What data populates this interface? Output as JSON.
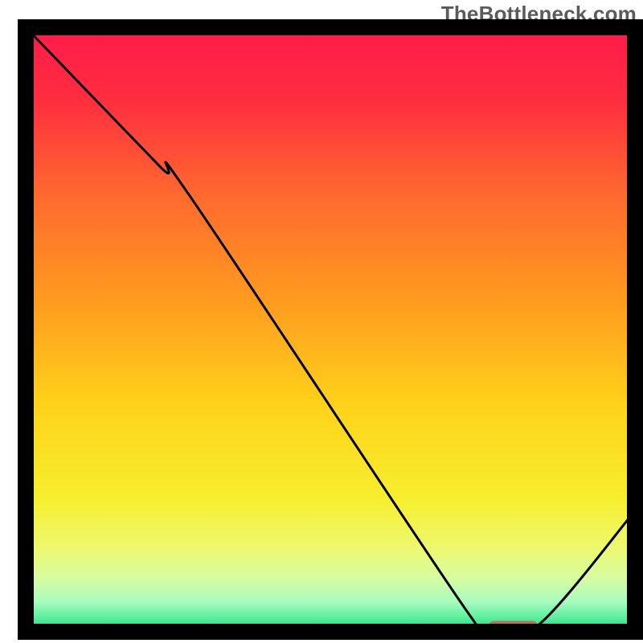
{
  "watermark": "TheBottleneck.com",
  "colors": {
    "frame": "#000000",
    "curve": "#000000",
    "marker": "#d9635f",
    "gradient_stops": [
      {
        "offset": 0.0,
        "color": "#ff1a4b"
      },
      {
        "offset": 0.12,
        "color": "#ff2e3f"
      },
      {
        "offset": 0.28,
        "color": "#ff6a2e"
      },
      {
        "offset": 0.45,
        "color": "#ff9a1f"
      },
      {
        "offset": 0.62,
        "color": "#ffd11a"
      },
      {
        "offset": 0.78,
        "color": "#f6ef2e"
      },
      {
        "offset": 0.86,
        "color": "#eef86e"
      },
      {
        "offset": 0.91,
        "color": "#d8fca0"
      },
      {
        "offset": 0.95,
        "color": "#a8fcc0"
      },
      {
        "offset": 0.975,
        "color": "#5ff0a0"
      },
      {
        "offset": 1.0,
        "color": "#18d97a"
      }
    ]
  },
  "chart_data": {
    "type": "line",
    "title": "",
    "xlabel": "",
    "ylabel": "",
    "xlim": [
      0,
      100
    ],
    "ylim": [
      0,
      100
    ],
    "grid": false,
    "curve": [
      {
        "x": 0,
        "y": 100
      },
      {
        "x": 22,
        "y": 77
      },
      {
        "x": 27,
        "y": 72
      },
      {
        "x": 72,
        "y": 4
      },
      {
        "x": 76,
        "y": 1
      },
      {
        "x": 84,
        "y": 1
      },
      {
        "x": 100,
        "y": 20
      }
    ],
    "optimum_marker": {
      "x_start": 76,
      "x_end": 84,
      "y": 1
    }
  }
}
